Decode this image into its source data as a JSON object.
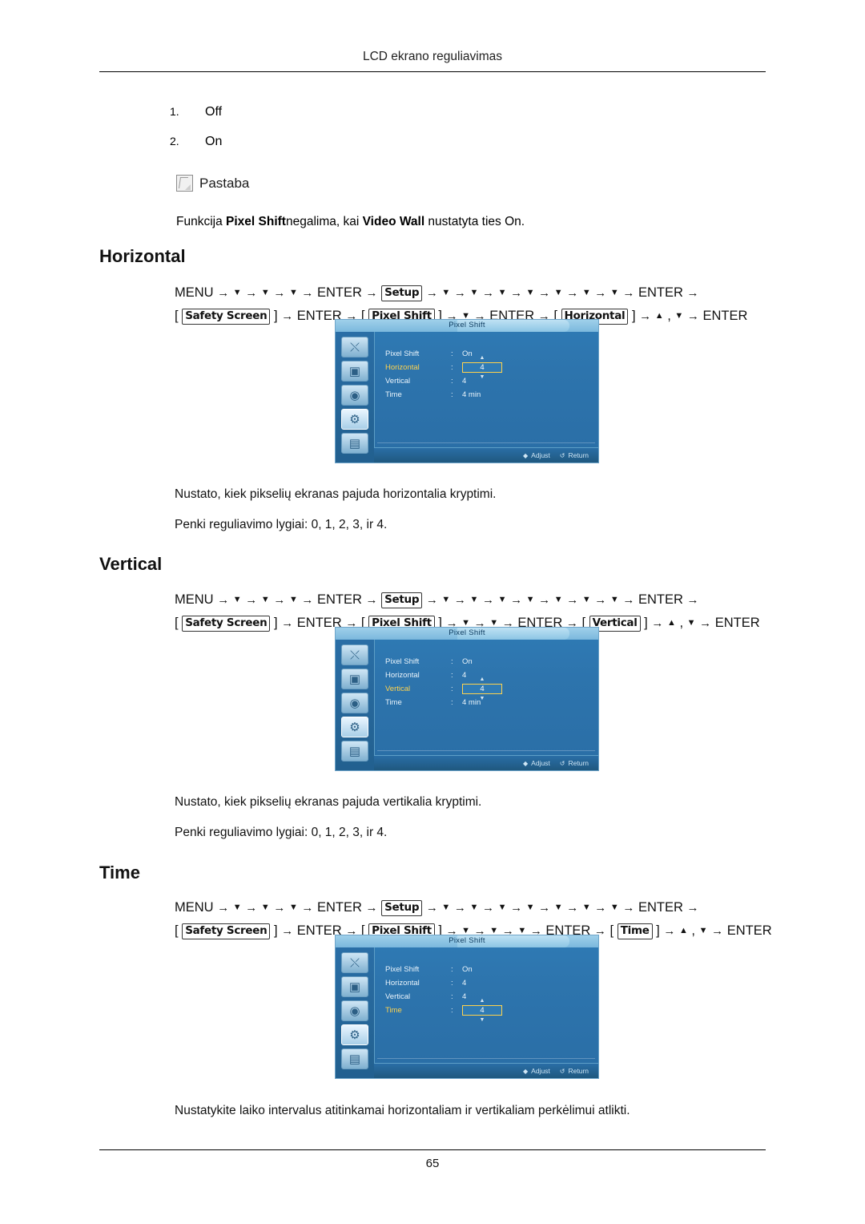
{
  "header": {
    "title": "LCD ekrano reguliavimas"
  },
  "footer": {
    "page_number": "65"
  },
  "options": [
    {
      "index": "1.",
      "label": "Off"
    },
    {
      "index": "2.",
      "label": "On"
    }
  ],
  "note": {
    "icon": "note-pencil-icon",
    "title": "Pastaba",
    "text_prefix": "Funkcija ",
    "text_bold1": "Pixel Shift",
    "text_mid": "negalima, kai ",
    "text_bold2": "Video Wall",
    "text_suffix": " nustatyta ties On."
  },
  "sections": [
    {
      "title": "Horizontal",
      "path_line1": [
        {
          "t": "MENU",
          "type": "plain"
        },
        {
          "t": "→",
          "type": "arrow"
        },
        {
          "t": "▼",
          "type": "down"
        },
        {
          "t": "→",
          "type": "arrow"
        },
        {
          "t": "▼",
          "type": "down"
        },
        {
          "t": "→",
          "type": "arrow"
        },
        {
          "t": "▼",
          "type": "down"
        },
        {
          "t": "→",
          "type": "arrow"
        },
        {
          "t": "ENTER",
          "type": "plain"
        },
        {
          "t": "→",
          "type": "arrow"
        },
        {
          "t": "Setup",
          "type": "boxed"
        },
        {
          "t": "→",
          "type": "arrow"
        },
        {
          "t": "▼",
          "type": "down"
        },
        {
          "t": "→",
          "type": "arrow"
        },
        {
          "t": "▼",
          "type": "down"
        },
        {
          "t": "→",
          "type": "arrow"
        },
        {
          "t": "▼",
          "type": "down"
        },
        {
          "t": "→",
          "type": "arrow"
        },
        {
          "t": "▼",
          "type": "down"
        },
        {
          "t": "→",
          "type": "arrow"
        },
        {
          "t": "▼",
          "type": "down"
        },
        {
          "t": "→",
          "type": "arrow"
        },
        {
          "t": "▼",
          "type": "down"
        },
        {
          "t": "→",
          "type": "arrow"
        },
        {
          "t": "▼",
          "type": "down"
        },
        {
          "t": "→",
          "type": "arrow"
        },
        {
          "t": "ENTER",
          "type": "plain"
        },
        {
          "t": "→",
          "type": "arrow"
        }
      ],
      "path_line2": [
        {
          "t": "[",
          "type": "plain"
        },
        {
          "t": "Safety Screen",
          "type": "boxed"
        },
        {
          "t": "]",
          "type": "plain"
        },
        {
          "t": "→",
          "type": "arrow"
        },
        {
          "t": "ENTER",
          "type": "plain"
        },
        {
          "t": "→",
          "type": "arrow"
        },
        {
          "t": "[",
          "type": "plain"
        },
        {
          "t": "Pixel Shift",
          "type": "boxed"
        },
        {
          "t": "]",
          "type": "plain"
        },
        {
          "t": "→",
          "type": "arrow"
        },
        {
          "t": "▼",
          "type": "down"
        },
        {
          "t": "→",
          "type": "arrow"
        },
        {
          "t": "ENTER",
          "type": "plain"
        },
        {
          "t": "→",
          "type": "arrow"
        },
        {
          "t": "[",
          "type": "plain"
        },
        {
          "t": "Horizontal",
          "type": "boxed"
        },
        {
          "t": "]",
          "type": "plain"
        },
        {
          "t": "→",
          "type": "arrow"
        },
        {
          "t": "▲",
          "type": "up"
        },
        {
          "t": ",",
          "type": "plain"
        },
        {
          "t": "▼",
          "type": "down"
        },
        {
          "t": "→",
          "type": "arrow"
        },
        {
          "t": "ENTER",
          "type": "plain"
        }
      ],
      "osd": {
        "title": "Pixel Shift",
        "rows": [
          {
            "label": "Pixel Shift",
            "colon": ":",
            "value": "On",
            "active": false,
            "spinner": false
          },
          {
            "label": "Horizontal",
            "colon": ":",
            "value": "4",
            "active": true,
            "spinner": true
          },
          {
            "label": "Vertical",
            "colon": ":",
            "value": "4",
            "active": false,
            "spinner": false
          },
          {
            "label": "Time",
            "colon": ":",
            "value": "4 min",
            "active": false,
            "spinner": false
          }
        ],
        "selected_icon_index": 3,
        "footer": [
          {
            "glyph": "◆",
            "label": "Adjust"
          },
          {
            "glyph": "↺",
            "label": "Return"
          }
        ]
      },
      "captions": [
        "Nustato, kiek pikselių ekranas pajuda horizontalia kryptimi.",
        "Penki reguliavimo lygiai: 0, 1, 2, 3, ir 4."
      ]
    },
    {
      "title": "Vertical",
      "path_line1": [
        {
          "t": "MENU",
          "type": "plain"
        },
        {
          "t": "→",
          "type": "arrow"
        },
        {
          "t": "▼",
          "type": "down"
        },
        {
          "t": "→",
          "type": "arrow"
        },
        {
          "t": "▼",
          "type": "down"
        },
        {
          "t": "→",
          "type": "arrow"
        },
        {
          "t": "▼",
          "type": "down"
        },
        {
          "t": "→",
          "type": "arrow"
        },
        {
          "t": "ENTER",
          "type": "plain"
        },
        {
          "t": "→",
          "type": "arrow"
        },
        {
          "t": "Setup",
          "type": "boxed"
        },
        {
          "t": "→",
          "type": "arrow"
        },
        {
          "t": "▼",
          "type": "down"
        },
        {
          "t": "→",
          "type": "arrow"
        },
        {
          "t": "▼",
          "type": "down"
        },
        {
          "t": "→",
          "type": "arrow"
        },
        {
          "t": "▼",
          "type": "down"
        },
        {
          "t": "→",
          "type": "arrow"
        },
        {
          "t": "▼",
          "type": "down"
        },
        {
          "t": "→",
          "type": "arrow"
        },
        {
          "t": "▼",
          "type": "down"
        },
        {
          "t": "→",
          "type": "arrow"
        },
        {
          "t": "▼",
          "type": "down"
        },
        {
          "t": "→",
          "type": "arrow"
        },
        {
          "t": "▼",
          "type": "down"
        },
        {
          "t": "→",
          "type": "arrow"
        },
        {
          "t": "ENTER",
          "type": "plain"
        },
        {
          "t": "→",
          "type": "arrow"
        }
      ],
      "path_line2": [
        {
          "t": "[",
          "type": "plain"
        },
        {
          "t": "Safety Screen",
          "type": "boxed"
        },
        {
          "t": "]",
          "type": "plain"
        },
        {
          "t": "→",
          "type": "arrow"
        },
        {
          "t": "ENTER",
          "type": "plain"
        },
        {
          "t": "→",
          "type": "arrow"
        },
        {
          "t": "[",
          "type": "plain"
        },
        {
          "t": "Pixel Shift",
          "type": "boxed"
        },
        {
          "t": "]",
          "type": "plain"
        },
        {
          "t": "→",
          "type": "arrow"
        },
        {
          "t": "▼",
          "type": "down"
        },
        {
          "t": "→",
          "type": "arrow"
        },
        {
          "t": "▼",
          "type": "down"
        },
        {
          "t": "→",
          "type": "arrow"
        },
        {
          "t": "ENTER",
          "type": "plain"
        },
        {
          "t": "→",
          "type": "arrow"
        },
        {
          "t": "[",
          "type": "plain"
        },
        {
          "t": "Vertical",
          "type": "boxed"
        },
        {
          "t": "]",
          "type": "plain"
        },
        {
          "t": "→",
          "type": "arrow"
        },
        {
          "t": "▲",
          "type": "up"
        },
        {
          "t": ",",
          "type": "plain"
        },
        {
          "t": "▼",
          "type": "down"
        },
        {
          "t": "→",
          "type": "arrow"
        },
        {
          "t": "ENTER",
          "type": "plain"
        }
      ],
      "osd": {
        "title": "Pixel Shift",
        "rows": [
          {
            "label": "Pixel Shift",
            "colon": ":",
            "value": "On",
            "active": false,
            "spinner": false
          },
          {
            "label": "Horizontal",
            "colon": ":",
            "value": "4",
            "active": false,
            "spinner": false
          },
          {
            "label": "Vertical",
            "colon": ":",
            "value": "4",
            "active": true,
            "spinner": true
          },
          {
            "label": "Time",
            "colon": ":",
            "value": "4 min",
            "active": false,
            "spinner": false
          }
        ],
        "selected_icon_index": 3,
        "footer": [
          {
            "glyph": "◆",
            "label": "Adjust"
          },
          {
            "glyph": "↺",
            "label": "Return"
          }
        ]
      },
      "captions": [
        "Nustato, kiek pikselių ekranas pajuda vertikalia kryptimi.",
        "Penki reguliavimo lygiai: 0, 1, 2, 3, ir 4."
      ]
    },
    {
      "title": "Time",
      "path_line1": [
        {
          "t": "MENU",
          "type": "plain"
        },
        {
          "t": "→",
          "type": "arrow"
        },
        {
          "t": "▼",
          "type": "down"
        },
        {
          "t": "→",
          "type": "arrow"
        },
        {
          "t": "▼",
          "type": "down"
        },
        {
          "t": "→",
          "type": "arrow"
        },
        {
          "t": "▼",
          "type": "down"
        },
        {
          "t": "→",
          "type": "arrow"
        },
        {
          "t": "ENTER",
          "type": "plain"
        },
        {
          "t": "→",
          "type": "arrow"
        },
        {
          "t": "Setup",
          "type": "boxed"
        },
        {
          "t": "→",
          "type": "arrow"
        },
        {
          "t": "▼",
          "type": "down"
        },
        {
          "t": "→",
          "type": "arrow"
        },
        {
          "t": "▼",
          "type": "down"
        },
        {
          "t": "→",
          "type": "arrow"
        },
        {
          "t": "▼",
          "type": "down"
        },
        {
          "t": "→",
          "type": "arrow"
        },
        {
          "t": "▼",
          "type": "down"
        },
        {
          "t": "→",
          "type": "arrow"
        },
        {
          "t": "▼",
          "type": "down"
        },
        {
          "t": "→",
          "type": "arrow"
        },
        {
          "t": "▼",
          "type": "down"
        },
        {
          "t": "→",
          "type": "arrow"
        },
        {
          "t": "▼",
          "type": "down"
        },
        {
          "t": "→",
          "type": "arrow"
        },
        {
          "t": "ENTER",
          "type": "plain"
        },
        {
          "t": "→",
          "type": "arrow"
        }
      ],
      "path_line2": [
        {
          "t": "[",
          "type": "plain"
        },
        {
          "t": "Safety Screen",
          "type": "boxed"
        },
        {
          "t": "]",
          "type": "plain"
        },
        {
          "t": "→",
          "type": "arrow"
        },
        {
          "t": "ENTER",
          "type": "plain"
        },
        {
          "t": "→",
          "type": "arrow"
        },
        {
          "t": "[",
          "type": "plain"
        },
        {
          "t": "Pixel Shift",
          "type": "boxed"
        },
        {
          "t": "]",
          "type": "plain"
        },
        {
          "t": "→",
          "type": "arrow"
        },
        {
          "t": "▼",
          "type": "down"
        },
        {
          "t": "→",
          "type": "arrow"
        },
        {
          "t": "▼",
          "type": "down"
        },
        {
          "t": "→",
          "type": "arrow"
        },
        {
          "t": "▼",
          "type": "down"
        },
        {
          "t": "→",
          "type": "arrow"
        },
        {
          "t": "ENTER",
          "type": "plain"
        },
        {
          "t": "→",
          "type": "arrow"
        },
        {
          "t": "[",
          "type": "plain"
        },
        {
          "t": "Time",
          "type": "boxed"
        },
        {
          "t": "]",
          "type": "plain"
        },
        {
          "t": "→",
          "type": "arrow"
        },
        {
          "t": "▲",
          "type": "up"
        },
        {
          "t": ",",
          "type": "plain"
        },
        {
          "t": "▼",
          "type": "down"
        },
        {
          "t": "→",
          "type": "arrow"
        },
        {
          "t": "ENTER",
          "type": "plain"
        }
      ],
      "osd": {
        "title": "Pixel Shift",
        "rows": [
          {
            "label": "Pixel Shift",
            "colon": ":",
            "value": "On",
            "active": false,
            "spinner": false
          },
          {
            "label": "Horizontal",
            "colon": ":",
            "value": "4",
            "active": false,
            "spinner": false
          },
          {
            "label": "Vertical",
            "colon": ":",
            "value": "4",
            "active": false,
            "spinner": false
          },
          {
            "label": "Time",
            "colon": ":",
            "value": "4",
            "active": true,
            "spinner": true
          }
        ],
        "selected_icon_index": 3,
        "footer": [
          {
            "glyph": "◆",
            "label": "Adjust"
          },
          {
            "glyph": "↺",
            "label": "Return"
          }
        ]
      },
      "captions": [
        "Nustatykite laiko intervalus atitinkamai horizontaliam ir vertikaliam perkėlimui atlikti."
      ]
    }
  ],
  "osd_sidebar_icons": [
    "input-icon",
    "picture-icon",
    "sound-icon",
    "setup-icon",
    "multi-control-icon"
  ]
}
